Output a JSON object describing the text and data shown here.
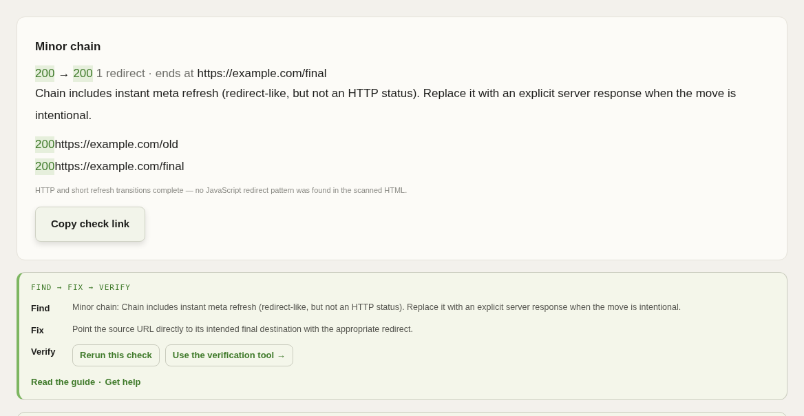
{
  "result_card": {
    "title": "Minor chain",
    "summary": {
      "from_status": "200",
      "arrow": "→",
      "to_status": "200",
      "meta": "1 redirect · ends at",
      "final_url": "https://example.com/final"
    },
    "description": "Chain includes instant meta refresh (redirect-like, but not an HTTP status). Replace it with an explicit server response when the move is intentional.",
    "hops": [
      {
        "status": "200",
        "url": "https://example.com/old"
      },
      {
        "status": "200",
        "url": "https://example.com/final"
      }
    ],
    "note": "HTTP and short refresh transitions complete — no JavaScript redirect pattern was found in the scanned HTML.",
    "copy_button": "Copy check link"
  },
  "guide_card": {
    "heading": "FIND → FIX → VERIFY",
    "rows": [
      {
        "label": "Find",
        "kind": "text",
        "text": "Minor chain: Chain includes instant meta refresh (redirect-like, but not an HTTP status). Replace it with an explicit server response when the move is intentional."
      },
      {
        "label": "Fix",
        "kind": "text",
        "text": "Point the source URL directly to its intended final destination with the appropriate redirect."
      },
      {
        "label": "Verify",
        "kind": "buttons",
        "buttons": [
          "Rerun this check",
          "Use the verification tool →"
        ]
      }
    ],
    "links": [
      "Read the guide",
      "Get help"
    ],
    "link_separator": "·"
  }
}
